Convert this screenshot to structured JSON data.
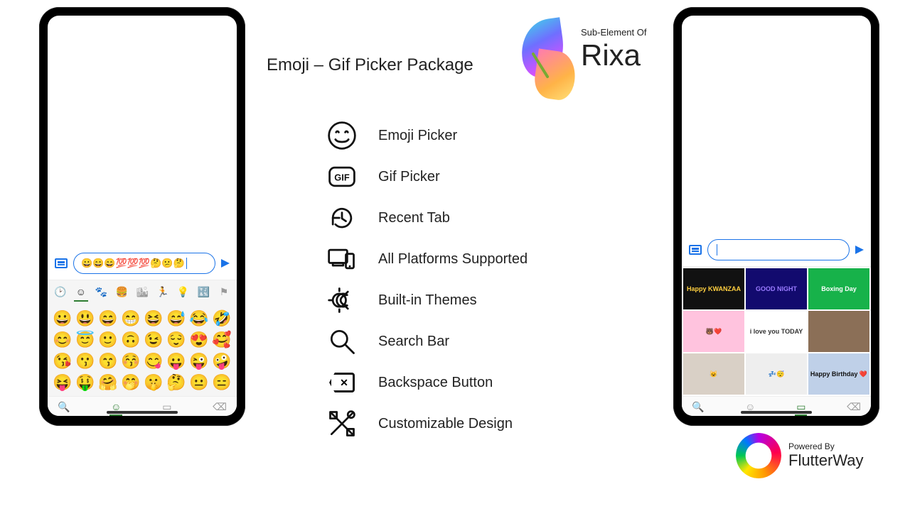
{
  "title": "Emoji – Gif Picker Package",
  "brand": {
    "sub": "Sub-Element Of",
    "name": "Rixa"
  },
  "footer": {
    "sub": "Powered By",
    "name": "FlutterWay"
  },
  "features": [
    {
      "label": "Emoji Picker",
      "icon": "smile-icon"
    },
    {
      "label": "Gif Picker",
      "icon": "gif-icon"
    },
    {
      "label": "Recent Tab",
      "icon": "history-icon"
    },
    {
      "label": "All Platforms Supported",
      "icon": "devices-icon"
    },
    {
      "label": "Built-in Themes",
      "icon": "theme-icon"
    },
    {
      "label": "Search Bar",
      "icon": "search-icon"
    },
    {
      "label": "Backspace Button",
      "icon": "backspace-icon"
    },
    {
      "label": "Customizable Design",
      "icon": "design-icon"
    }
  ],
  "left_phone": {
    "input": "😀😄😄💯💯💯🤔😕🤔",
    "category_tabs": [
      {
        "name": "recent-icon",
        "active": false
      },
      {
        "name": "smileys-icon",
        "active": true
      },
      {
        "name": "animals-icon",
        "active": false
      },
      {
        "name": "food-icon",
        "active": false
      },
      {
        "name": "travel-icon",
        "active": false
      },
      {
        "name": "activity-icon",
        "active": false
      },
      {
        "name": "objects-icon",
        "active": false
      },
      {
        "name": "symbols-icon",
        "active": false
      },
      {
        "name": "flags-icon",
        "active": false
      }
    ],
    "emojis": [
      "😀",
      "😃",
      "😄",
      "😁",
      "😆",
      "😅",
      "😂",
      "🤣",
      "😊",
      "😇",
      "🙂",
      "🙃",
      "😉",
      "😌",
      "😍",
      "🥰",
      "😘",
      "😗",
      "😙",
      "😚",
      "😋",
      "😛",
      "😜",
      "🤪",
      "😝",
      "🤑",
      "🤗",
      "🤭",
      "🤫",
      "🤔",
      "😐",
      "😑"
    ],
    "bottom_bar": [
      {
        "name": "search-icon",
        "active": false
      },
      {
        "name": "emoji-tab-icon",
        "active": true
      },
      {
        "name": "gif-tab-icon",
        "active": false
      },
      {
        "name": "backspace-icon",
        "active": false
      }
    ]
  },
  "right_phone": {
    "input": "",
    "gifs": [
      {
        "label": "Happy KWANZAA",
        "bg": "#111111",
        "fg": "#ffd040"
      },
      {
        "label": "GOOD NIGHT",
        "bg": "#120a6e",
        "fg": "#9a7bff"
      },
      {
        "label": "Boxing Day",
        "bg": "#17b24a",
        "fg": "#ffffff"
      },
      {
        "label": "🐻❤️",
        "bg": "#ffc3de",
        "fg": "#6b3d2e"
      },
      {
        "label": "i love you TODAY",
        "bg": "#ffffff",
        "fg": "#333333"
      },
      {
        "label": "",
        "bg": "#8b6f57",
        "fg": "#ffffff"
      },
      {
        "label": "😺",
        "bg": "#d9d0c6",
        "fg": "#000000"
      },
      {
        "label": "💤😴",
        "bg": "#eeeeee",
        "fg": "#000000"
      },
      {
        "label": "Happy Birthday ❤️",
        "bg": "#bfd0e8",
        "fg": "#111111"
      }
    ],
    "bottom_bar": [
      {
        "name": "search-icon",
        "active": false
      },
      {
        "name": "emoji-tab-icon",
        "active": false
      },
      {
        "name": "gif-tab-icon",
        "active": true
      },
      {
        "name": "backspace-icon",
        "active": false
      }
    ]
  }
}
